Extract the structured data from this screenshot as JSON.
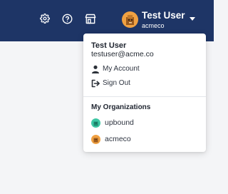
{
  "header": {
    "icons": [
      "gear-icon",
      "help-icon",
      "store-icon"
    ],
    "user": {
      "name": "Test User",
      "org": "acmeco"
    }
  },
  "dropdown": {
    "name": "Test User",
    "email": "testuser@acme.co",
    "items": [
      {
        "label": "My Account",
        "icon": "person-icon"
      },
      {
        "label": "Sign Out",
        "icon": "sign-out-icon"
      }
    ],
    "section_title": "My Organizations",
    "organizations": [
      {
        "name": "upbound",
        "color": "#3ec7a4"
      },
      {
        "name": "acmeco",
        "color": "#f0a142"
      }
    ]
  },
  "colors": {
    "header_bg": "#1e3566",
    "page_bg": "#f4f5f7",
    "avatar_orange": "#f0a142",
    "avatar_teal": "#3ec7a4"
  }
}
